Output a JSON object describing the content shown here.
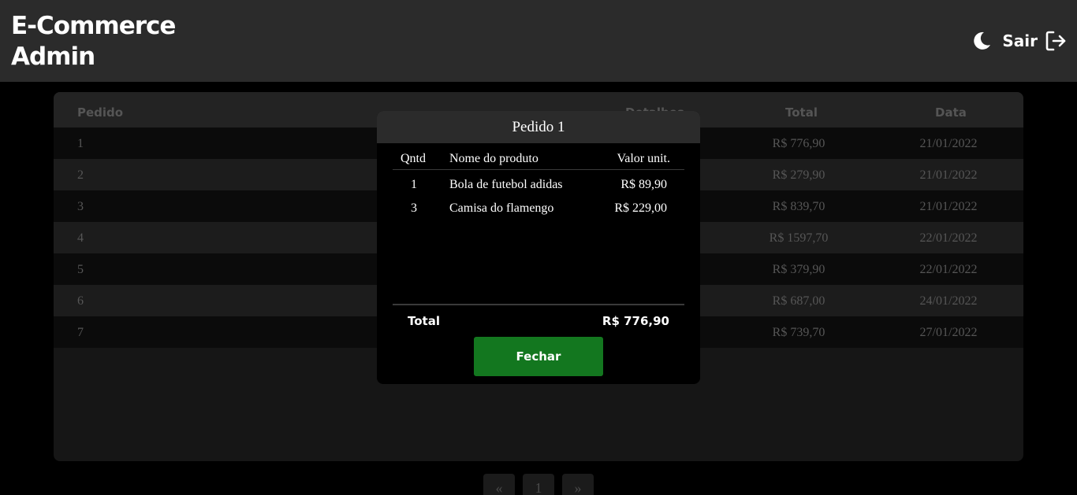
{
  "header": {
    "brand_line1": "E-Commerce",
    "brand_line2": "Admin",
    "theme_icon": "moon-icon",
    "logout_label": "Sair",
    "logout_icon": "logout-icon"
  },
  "table": {
    "columns": {
      "pedido": "Pedido",
      "detalhes": "Detalhes",
      "total": "Total",
      "data": "Data"
    },
    "rows": [
      {
        "id": "1",
        "total": "R$ 776,90",
        "date": "21/01/2022"
      },
      {
        "id": "2",
        "total": "R$ 279,90",
        "date": "21/01/2022"
      },
      {
        "id": "3",
        "total": "R$ 839,70",
        "date": "21/01/2022"
      },
      {
        "id": "4",
        "total": "R$ 1597,70",
        "date": "22/01/2022"
      },
      {
        "id": "5",
        "total": "R$ 379,90",
        "date": "22/01/2022"
      },
      {
        "id": "6",
        "total": "R$ 687,00",
        "date": "24/01/2022"
      },
      {
        "id": "7",
        "total": "R$ 739,70",
        "date": "27/01/2022"
      }
    ]
  },
  "pagination": {
    "prev": "«",
    "current": "1",
    "next": "»"
  },
  "modal": {
    "title": "Pedido 1",
    "headers": {
      "qtd": "Qntd",
      "nome": "Nome do produto",
      "valor": "Valor unit."
    },
    "items": [
      {
        "qtd": "1",
        "nome": "Bola de futebol adidas",
        "valor": "R$ 89,90"
      },
      {
        "qtd": "3",
        "nome": "Camisa do flamengo",
        "valor": "R$ 229,00"
      }
    ],
    "total_label": "Total",
    "total_value": "R$ 776,90",
    "close_label": "Fechar"
  },
  "colors": {
    "header_bg": "#2b2b2b",
    "accent_green": "#13771f",
    "page_bg": "#000000"
  }
}
